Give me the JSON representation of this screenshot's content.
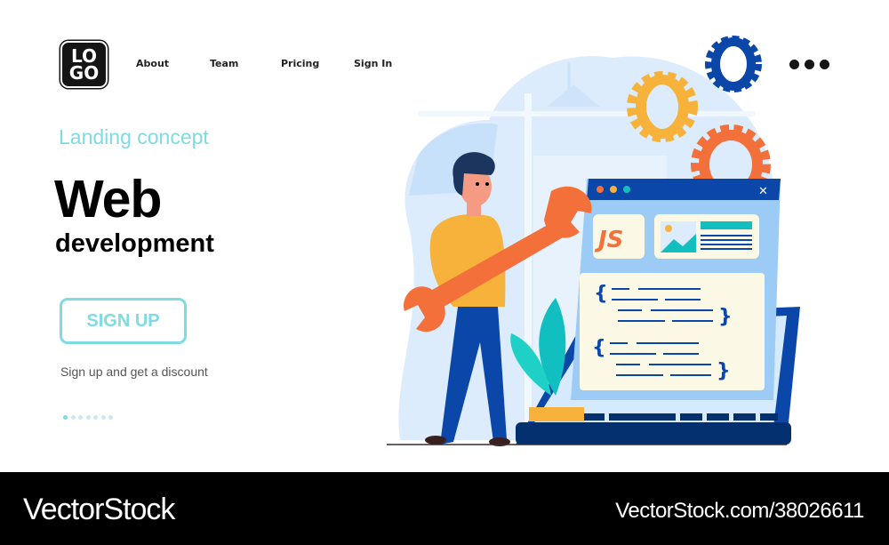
{
  "header": {
    "logo": {
      "line1": "LO",
      "line2": "GO"
    },
    "nav": [
      {
        "label": "About"
      },
      {
        "label": "Team"
      },
      {
        "label": "Pricing"
      },
      {
        "label": "Sign In"
      }
    ],
    "more_icon": "more-horizontal-icon"
  },
  "hero": {
    "subtitle": "Landing concept",
    "title": "Web",
    "title_line2": "development",
    "cta_label": "SIGN UP",
    "cta_note": "Sign up and get a discount",
    "pagination": {
      "total": 7,
      "active": 1
    }
  },
  "illustration": {
    "code_badge": "JS",
    "close_glyph": "✕",
    "colors": {
      "accent_cyan": "#7fdbe2",
      "orange": "#f4703a",
      "yellow": "#f7b23b",
      "blue_dark": "#0a47a9",
      "blue_light": "#9ccbf5",
      "teal": "#12bfc0",
      "cream": "#fbf8e6"
    }
  },
  "footer": {
    "brand": "VectorStock",
    "url": "VectorStock.com/38026611"
  }
}
